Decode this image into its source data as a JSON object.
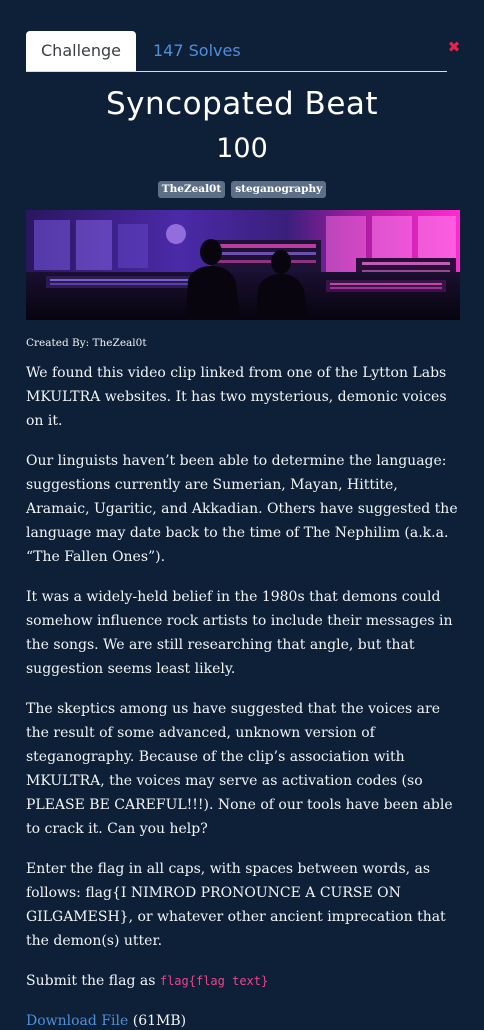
{
  "tabs": {
    "challenge_label": "Challenge",
    "solves_label": "147 Solves"
  },
  "close_glyph": "✖",
  "challenge": {
    "title": "Syncopated Beat",
    "points": "100",
    "tags": [
      "TheZeal0t",
      "steganography"
    ],
    "created_by": "Created By: TheZeal0t"
  },
  "description": {
    "p1": "We found this video clip linked from one of the Lytton Labs MKULTRA websites. It has two mysterious, demonic voices on it.",
    "p2": "Our linguists haven’t been able to determine the language: suggestions currently are Sumerian, Mayan, Hittite, Aramaic, Ugaritic, and Akkadian. Others have suggested the language may date back to the time of The Nephilim (a.k.a. “The Fallen Ones”).",
    "p3": "It was a widely-held belief in the 1980s that demons could somehow influence rock artists to include their messages in the songs. We are still researching that angle, but that suggestion seems least likely.",
    "p4": "The skeptics among us have suggested that the voices are the result of some advanced, unknown version of steganography. Because of the clip’s association with MKULTRA, the voices may serve as activation codes (so PLEASE BE CAREFUL!!!). None of our tools have been able to crack it. Can you help?",
    "p5": "Enter the flag in all caps, with spaces between words, as follows: flag{I NIMROD PRONOUNCE A CURSE ON GILGAMESH}, or whatever other ancient imprecation that the demon(s) utter.",
    "submit_prefix": "Submit the flag as ",
    "submit_code": "flag{flag text}",
    "download_label": "Download File",
    "download_size": " (61MB)"
  },
  "colors": {
    "background": "#0e2037",
    "link": "#4f8fd8",
    "close": "#e4244b",
    "code": "#e8458c",
    "tag_bg": "#5c6f86"
  }
}
